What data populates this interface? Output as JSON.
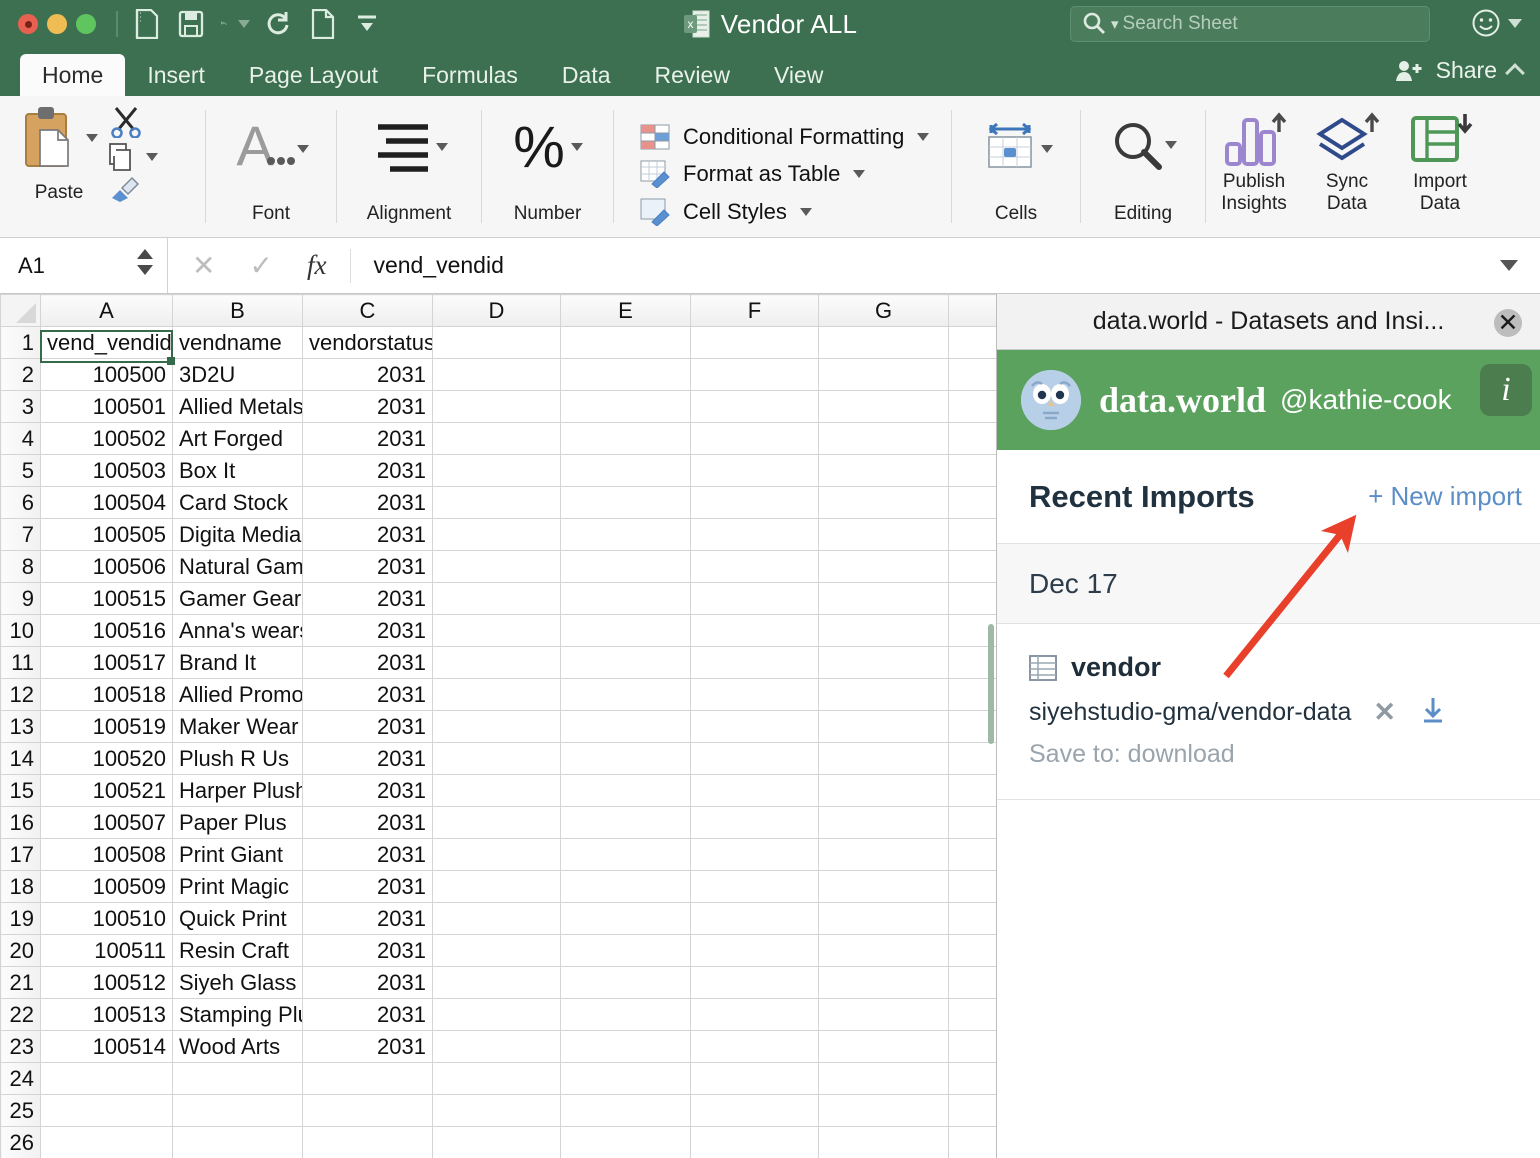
{
  "colors": {
    "brand_green": "#3d7050",
    "dw_green": "#5ba25f",
    "accent_blue": "#5b8ec6",
    "annotation_red": "#e8402a",
    "selection_green": "#356b4a"
  },
  "titlebar": {
    "document_title": "Vendor ALL",
    "excel_icon": "excel-doc-icon",
    "traffic_lights": [
      "close",
      "minimize",
      "zoom"
    ],
    "quick_access": [
      {
        "name": "new-from-template-icon",
        "label": "New from template"
      },
      {
        "name": "save-icon",
        "label": "Save"
      },
      {
        "name": "undo-icon",
        "label": "Undo"
      },
      {
        "name": "redo-icon",
        "label": "Redo"
      },
      {
        "name": "new-document-icon",
        "label": "New"
      },
      {
        "name": "customize-toolbar-icon",
        "label": "Customize"
      }
    ],
    "search": {
      "placeholder": "Search Sheet",
      "icon": "search-icon"
    },
    "account": {
      "icon": "smiley-face-icon"
    }
  },
  "tabs": [
    {
      "label": "Home",
      "active": true
    },
    {
      "label": "Insert",
      "active": false
    },
    {
      "label": "Page Layout",
      "active": false
    },
    {
      "label": "Formulas",
      "active": false
    },
    {
      "label": "Data",
      "active": false
    },
    {
      "label": "Review",
      "active": false
    },
    {
      "label": "View",
      "active": false
    }
  ],
  "share": {
    "label": "Share",
    "icon": "person-plus-icon",
    "collapse_icon": "chevron-up-icon"
  },
  "ribbon": {
    "groups": [
      {
        "label": "Paste",
        "icon": "clipboard-icon",
        "extras": [
          "cut-scissors-icon",
          "copy-icon",
          "format-painter-icon"
        ]
      },
      {
        "label": "Font",
        "icon": "font-A-icon"
      },
      {
        "label": "Alignment",
        "icon": "alignment-lines-icon"
      },
      {
        "label": "Number",
        "icon": "percent-icon"
      },
      {
        "label": "Cells",
        "icon": "cells-icon"
      },
      {
        "label": "Editing",
        "icon": "magnifier-icon"
      }
    ],
    "styles_menu": [
      {
        "label": "Conditional Formatting",
        "icon": "conditional-formatting-icon"
      },
      {
        "label": "Format as Table",
        "icon": "format-as-table-icon"
      },
      {
        "label": "Cell Styles",
        "icon": "cell-styles-icon"
      }
    ],
    "addins": [
      {
        "label_line1": "Publish",
        "label_line2": "Insights",
        "icon": "publish-insights-icon"
      },
      {
        "label_line1": "Sync",
        "label_line2": "Data",
        "icon": "sync-data-icon"
      },
      {
        "label_line1": "Import",
        "label_line2": "Data",
        "icon": "import-data-icon"
      }
    ]
  },
  "formula_bar": {
    "name_box": "A1",
    "cancel_icon": "cancel-x-icon",
    "confirm_icon": "confirm-check-icon",
    "function_icon": "fx-icon",
    "value": "vend_vendid",
    "expand_icon": "chevron-down-icon"
  },
  "sheet": {
    "columns": [
      "A",
      "B",
      "C",
      "D",
      "E",
      "F",
      "G"
    ],
    "selected_cell": "A1",
    "rows": [
      {
        "n": "1",
        "A": "vend_vendid",
        "B": "vendname",
        "C": "vendorstatusid",
        "header": true
      },
      {
        "n": "2",
        "A": "100500",
        "B": "3D2U",
        "C": "2031"
      },
      {
        "n": "3",
        "A": "100501",
        "B": "Allied Metals",
        "C": "2031"
      },
      {
        "n": "4",
        "A": "100502",
        "B": "Art Forged",
        "C": "2031"
      },
      {
        "n": "5",
        "A": "100503",
        "B": "Box It",
        "C": "2031"
      },
      {
        "n": "6",
        "A": "100504",
        "B": "Card Stock",
        "C": "2031"
      },
      {
        "n": "7",
        "A": "100505",
        "B": "Digita Media",
        "C": "2031"
      },
      {
        "n": "8",
        "A": "100506",
        "B": "Natural Game",
        "C": "2031"
      },
      {
        "n": "9",
        "A": "100515",
        "B": "Gamer Gear",
        "C": "2031"
      },
      {
        "n": "10",
        "A": "100516",
        "B": "Anna's wears",
        "C": "2031"
      },
      {
        "n": "11",
        "A": "100517",
        "B": "Brand It",
        "C": "2031"
      },
      {
        "n": "12",
        "A": "100518",
        "B": "Allied Promo",
        "C": "2031"
      },
      {
        "n": "13",
        "A": "100519",
        "B": "Maker Wear",
        "C": "2031"
      },
      {
        "n": "14",
        "A": "100520",
        "B": "Plush R Us",
        "C": "2031"
      },
      {
        "n": "15",
        "A": "100521",
        "B": "Harper Plush",
        "C": "2031"
      },
      {
        "n": "16",
        "A": "100507",
        "B": "Paper Plus",
        "C": "2031"
      },
      {
        "n": "17",
        "A": "100508",
        "B": "Print Giant",
        "C": "2031"
      },
      {
        "n": "18",
        "A": "100509",
        "B": "Print Magic",
        "C": "2031"
      },
      {
        "n": "19",
        "A": "100510",
        "B": "Quick Print",
        "C": "2031"
      },
      {
        "n": "20",
        "A": "100511",
        "B": "Resin Craft",
        "C": "2031"
      },
      {
        "n": "21",
        "A": "100512",
        "B": "Siyeh Glass",
        "C": "2031"
      },
      {
        "n": "22",
        "A": "100513",
        "B": "Stamping Plus",
        "C": "2031"
      },
      {
        "n": "23",
        "A": "100514",
        "B": "Wood Arts",
        "C": "2031"
      },
      {
        "n": "24",
        "A": "",
        "B": "",
        "C": ""
      },
      {
        "n": "25",
        "A": "",
        "B": "",
        "C": ""
      },
      {
        "n": "26",
        "A": "",
        "B": "",
        "C": ""
      }
    ]
  },
  "panel": {
    "window_title": "data.world - Datasets and Insi...",
    "close_icon": "close-circle-icon",
    "brand": "data.world",
    "username": "@kathie-cook",
    "avatar_icon": "owl-avatar-icon",
    "info_icon": "info-i-icon",
    "recent_imports_label": "Recent Imports",
    "new_import_label": "+ New import",
    "date_group": "Dec 17",
    "import": {
      "table_icon": "table-icon",
      "name": "vendor",
      "path": "siyehstudio-gma/vendor-data",
      "remove_icon": "remove-x-icon",
      "download_icon": "download-arrow-icon",
      "save_to": "Save to: download"
    }
  },
  "annotation": {
    "type": "arrow",
    "color": "#e8402a",
    "points_to": "+ New import"
  }
}
